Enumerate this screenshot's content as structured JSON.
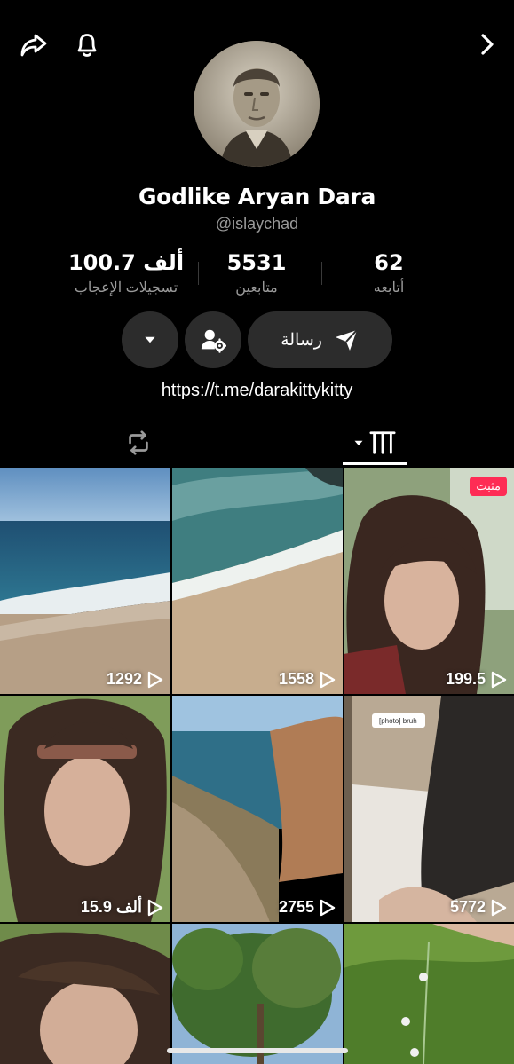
{
  "header": {
    "share_icon": "share-arrow-icon",
    "bell_icon": "bell-icon",
    "forward_icon": "chevron-right-icon"
  },
  "profile": {
    "display_name": "Godlike Aryan Dara",
    "username": "@islaychad",
    "link": "https://t.me/darakittykitty"
  },
  "stats": {
    "likes_value": "100.7 ألف",
    "likes_label": "تسجيلات الإعجاب",
    "followers_value": "5531",
    "followers_label": "متابعين",
    "following_value": "62",
    "following_label": "أتابعه"
  },
  "actions": {
    "message_label": "رسالة"
  },
  "videos": [
    {
      "views": "1292"
    },
    {
      "views": "1558"
    },
    {
      "views": "199.5",
      "pinned": "مثبت"
    },
    {
      "views": "15.9 ألف"
    },
    {
      "views": "2755"
    },
    {
      "views": "5772",
      "caption": "[photo] bruh"
    },
    {
      "views": ""
    },
    {
      "views": ""
    },
    {
      "views": ""
    }
  ],
  "colors": {
    "background": "#000000",
    "button_bg": "#2c2c2c",
    "muted_text": "#9a9a9a",
    "pinned_badge": "#fe2c55"
  }
}
